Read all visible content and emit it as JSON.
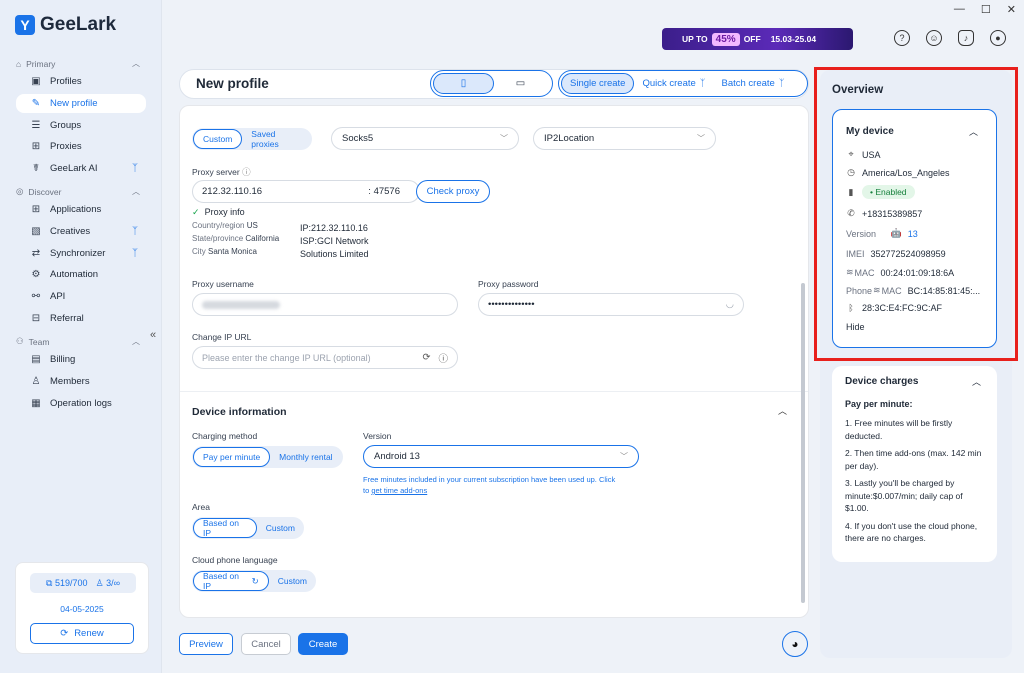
{
  "window": {
    "minimize": "—",
    "maximize": "☐",
    "close": "✕"
  },
  "app": {
    "name": "GeeLark"
  },
  "sidebar": {
    "primary_label": "Primary",
    "primary_items": [
      {
        "label": "Profiles"
      },
      {
        "label": "New profile"
      },
      {
        "label": "Groups"
      },
      {
        "label": "Proxies"
      },
      {
        "label": "GeeLark AI"
      }
    ],
    "discover_label": "Discover",
    "discover_items": [
      {
        "label": "Applications"
      },
      {
        "label": "Creatives"
      },
      {
        "label": "Synchronizer"
      },
      {
        "label": "Automation"
      },
      {
        "label": "API"
      },
      {
        "label": "Referral"
      }
    ],
    "team_label": "Team",
    "team_items": [
      {
        "label": "Billing"
      },
      {
        "label": "Members"
      },
      {
        "label": "Operation logs"
      }
    ],
    "usage": {
      "profiles": "519/700",
      "members": "3/∞",
      "date": "04-05-2025",
      "renew_label": "Renew"
    }
  },
  "promo": {
    "prefix": "UP TO",
    "percent": "45%",
    "suffix": "OFF",
    "dates": "15.03-25.04"
  },
  "header": {
    "title": "New profile",
    "create_tabs": [
      "Single create",
      "Quick create",
      "Batch create"
    ]
  },
  "proxy": {
    "mode_tabs": [
      "Custom",
      "Saved proxies"
    ],
    "type": "Socks5",
    "lookup": "IP2Location",
    "server_label": "Proxy server",
    "host": "212.32.110.16",
    "port": ": 47576",
    "check_label": "Check proxy",
    "info_label": "Proxy info",
    "country_label": "Country/region",
    "country": "US",
    "state_label": "State/province",
    "state": "California",
    "city_label": "City",
    "city": "Santa Monica",
    "ip_line": "IP:212.32.110.16",
    "isp_line1": "ISP:GCI Network",
    "isp_line2": "Solutions Limited",
    "username_label": "Proxy username",
    "password_label": "Proxy password",
    "password": "••••••••••••••",
    "change_ip_label": "Change IP URL",
    "change_ip_placeholder": "Please enter the change IP URL (optional)"
  },
  "device_info": {
    "title": "Device information",
    "charging_label": "Charging method",
    "charging_tabs": [
      "Pay per minute",
      "Monthly rental"
    ],
    "version_label": "Version",
    "version": "Android 13",
    "notice": "Free minutes included in your current subscription have been used up. Click",
    "notice_to": "to",
    "notice_link": "get time add-ons",
    "area_label": "Area",
    "area_tabs": [
      "Based on IP",
      "Custom"
    ],
    "lang_label": "Cloud phone language",
    "lang_tabs": [
      "Based on IP",
      "Custom"
    ]
  },
  "footer": {
    "preview": "Preview",
    "cancel": "Cancel",
    "create": "Create"
  },
  "overview": {
    "title": "Overview",
    "my_device": {
      "title": "My device",
      "country": "USA",
      "timezone": "America/Los_Angeles",
      "sim_status": "• Enabled",
      "phone": "+18315389857",
      "version_label": "Version",
      "version": "13",
      "imei_label": "IMEI",
      "imei": "352772524098959",
      "mac_label": "MAC",
      "mac": "00:24:01:09:18:6A",
      "phone_mac_label": "Phone",
      "phone_mac_label2": "MAC",
      "phone_mac": "BC:14:85:81:45:...",
      "bt": "28:3C:E4:FC:9C:AF",
      "hide_label": "Hide"
    },
    "charges": {
      "title": "Device charges",
      "subtitle": "Pay per minute:",
      "items": [
        "1. Free minutes will be firstly deducted.",
        "2. Then time add-ons (max. 142 min per day).",
        "3. Lastly you'll be charged by minute:$0.007/min; daily cap of $1.00.",
        "4. If you don't use the cloud phone, there are no charges."
      ]
    }
  }
}
